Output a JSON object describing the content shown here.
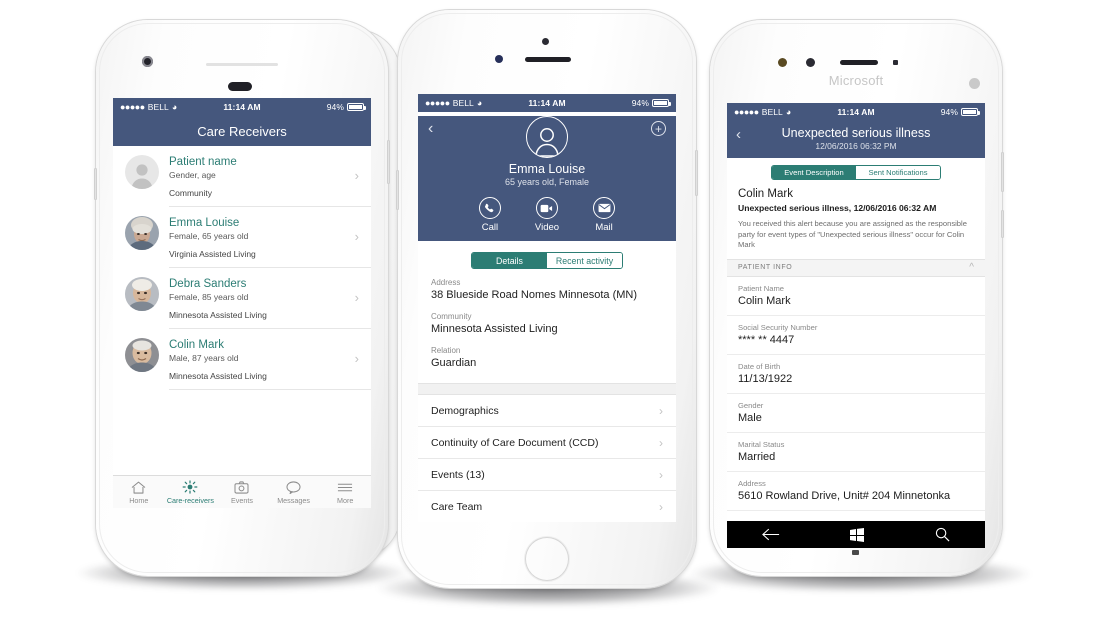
{
  "status_bar": {
    "carrier": "BELL",
    "time": "11:14 AM",
    "battery": "94%"
  },
  "colors": {
    "navy": "#45577d",
    "teal": "#2c7d74",
    "chrome": "#f4f4f4",
    "black": "#000000"
  },
  "phone1": {
    "title": "Care Receivers",
    "items": [
      {
        "name": "Patient name",
        "sub": "Gender, age",
        "community": "Community",
        "avatar": "placeholder-avatar-icon"
      },
      {
        "name": "Emma Louise",
        "sub": "Female, 65 years old",
        "community": "Virginia Assisted Living",
        "avatar": "photo-avatar"
      },
      {
        "name": "Debra Sanders",
        "sub": "Female, 85 years old",
        "community": "Minnesota Assisted Living",
        "avatar": "photo-avatar"
      },
      {
        "name": "Colin Mark",
        "sub": "Male, 87 years old",
        "community": "Minnesota Assisted Living",
        "avatar": "photo-avatar"
      }
    ],
    "tabs": [
      {
        "label": "Home",
        "icon": "home-icon",
        "active": false
      },
      {
        "label": "Care-receivers",
        "icon": "care-receivers-icon",
        "active": true
      },
      {
        "label": "Events",
        "icon": "camera-icon",
        "active": false
      },
      {
        "label": "Messages",
        "icon": "chat-icon",
        "active": false
      },
      {
        "label": "More",
        "icon": "menu-icon",
        "active": false
      }
    ]
  },
  "phone2": {
    "back": "back-chevron-icon",
    "add": "add-icon",
    "avatar": "person-outline-icon",
    "name": "Emma Louise",
    "sub": "65 years old, Female",
    "actions": [
      {
        "label": "Call",
        "icon": "phone-icon"
      },
      {
        "label": "Video",
        "icon": "video-icon"
      },
      {
        "label": "Mail",
        "icon": "mail-icon"
      }
    ],
    "segments": [
      {
        "label": "Details",
        "active": true
      },
      {
        "label": "Recent activity",
        "active": false
      }
    ],
    "fields": [
      {
        "key": "Address",
        "value": "38 Blueside Road Nomes Minnesota (MN)"
      },
      {
        "key": "Community",
        "value": "Minnesota Assisted Living"
      },
      {
        "key": "Relation",
        "value": "Guardian"
      }
    ],
    "menu": [
      "Demographics",
      "Continuity of Care Document  (CCD)",
      "Events (13)",
      "Care Team"
    ]
  },
  "phone3": {
    "brand": "Microsoft",
    "back": "back-chevron-icon",
    "title": "Unexpected serious illness",
    "date": "12/06/2016 06:32 PM",
    "segments": [
      {
        "label": "Event Description",
        "active": true
      },
      {
        "label": "Sent Notifications",
        "active": false
      }
    ],
    "event": {
      "patient": "Colin Mark",
      "type": "Unexpected serious illness, 12/06/2016 06:32 AM",
      "description": "You received this alert because you are assigned as the responsible party for event types of \"Unexpected serious illness\" occur for Colin Mark"
    },
    "section": {
      "label": "PATIENT INFO",
      "collapse_icon": "chevron-up-icon"
    },
    "fields": [
      {
        "key": "Patient Name",
        "value": "Colin Mark"
      },
      {
        "key": "Social Security Number",
        "value": "**** ** 4447"
      },
      {
        "key": "Date of Birth",
        "value": "11/13/1922"
      },
      {
        "key": "Gender",
        "value": "Male"
      },
      {
        "key": "Marital Status",
        "value": "Married"
      },
      {
        "key": "Address",
        "value": "5610 Rowland Drive, Unit# 204 Minnetonka"
      }
    ],
    "navbar": [
      {
        "icon": "back-arrow-icon",
        "label": "Back"
      },
      {
        "icon": "windows-logo-icon",
        "label": "Start"
      },
      {
        "icon": "search-icon",
        "label": "Search"
      }
    ]
  }
}
